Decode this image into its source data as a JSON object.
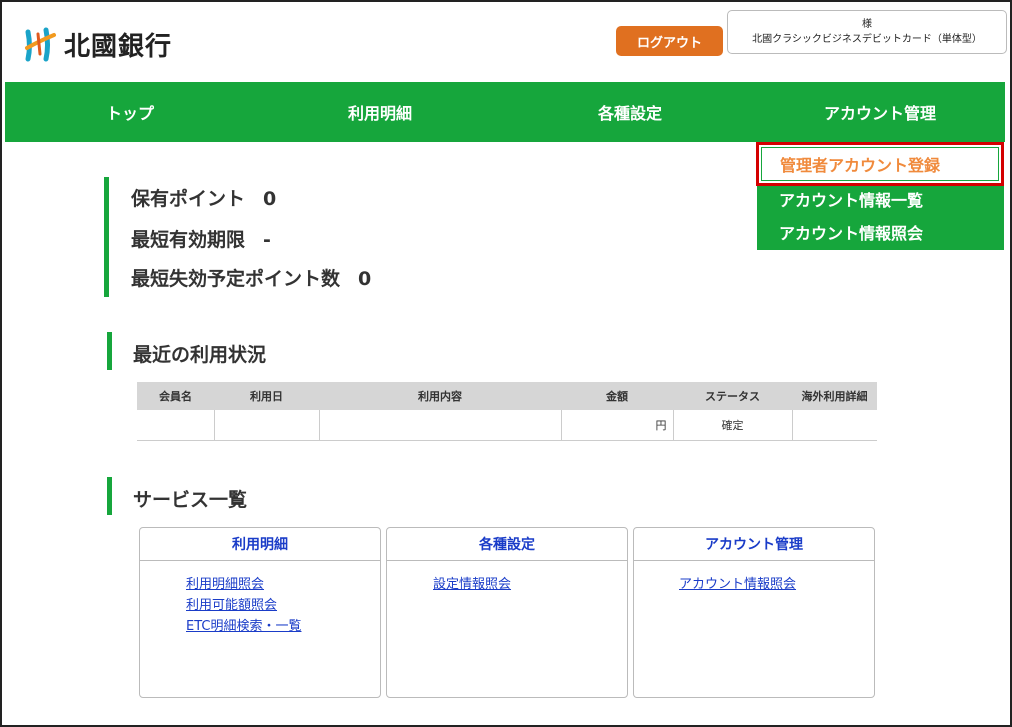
{
  "header": {
    "logo_text": "北國銀行",
    "logout_label": "ログアウト",
    "user_line1": "様",
    "user_line2": "北國クラシックビジネスデビットカード（単体型）"
  },
  "nav": {
    "items": [
      {
        "label": "トップ"
      },
      {
        "label": "利用明細"
      },
      {
        "label": "各種設定"
      },
      {
        "label": "アカウント管理"
      }
    ]
  },
  "dropdown": {
    "items": [
      {
        "label": "管理者アカウント登録"
      },
      {
        "label": "アカウント情報一覧"
      },
      {
        "label": "アカウント情報照会"
      }
    ]
  },
  "points": {
    "held_label": "保有ポイント",
    "held_value": "0",
    "expiry_label": "最短有効期限",
    "expiry_value": "-",
    "expiring_label": "最短失効予定ポイント数",
    "expiring_value": "0"
  },
  "recent": {
    "title": "最近の利用状況",
    "columns": [
      "会員名",
      "利用日",
      "利用内容",
      "金額",
      "ステータス",
      "海外利用詳細"
    ],
    "row": {
      "member": "",
      "date": "",
      "content": "",
      "amount": "円",
      "status": "確定",
      "overseas": ""
    }
  },
  "services": {
    "title": "サービス一覧",
    "boxes": [
      {
        "title": "利用明細",
        "links": [
          "利用明細照会",
          "利用可能額照会",
          "ETC明細検索・一覧"
        ]
      },
      {
        "title": "各種設定",
        "links": [
          "設定情報照会"
        ]
      },
      {
        "title": "アカウント管理",
        "links": [
          "アカウント情報照会"
        ]
      }
    ]
  },
  "colors": {
    "brand_green": "#16a63c",
    "logout_orange": "#e07020",
    "link_blue": "#1a3cc8",
    "highlight_red": "#d40000",
    "active_item_orange": "#f08a3c"
  }
}
